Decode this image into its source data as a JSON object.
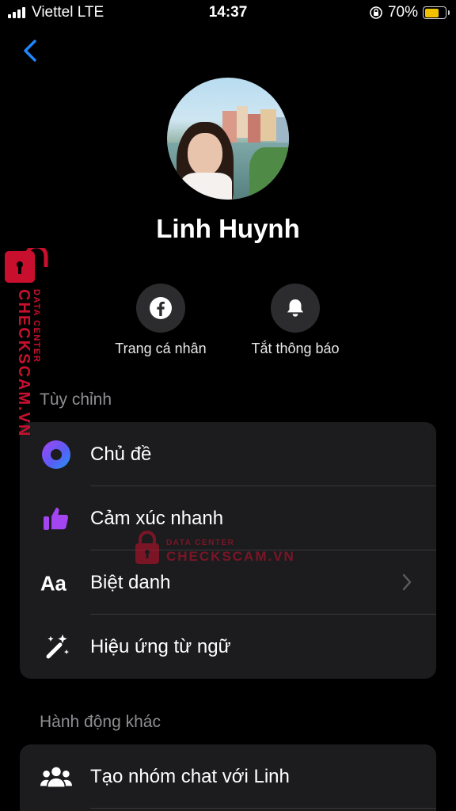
{
  "status_bar": {
    "carrier": "Viettel LTE",
    "time": "14:37",
    "battery_percent": "70%",
    "battery_level": 0.7
  },
  "profile": {
    "name": "Linh Huynh"
  },
  "actions": [
    {
      "label": "Trang cá nhân",
      "icon": "facebook-icon"
    },
    {
      "label": "Tắt thông báo",
      "icon": "bell-icon"
    }
  ],
  "customize": {
    "title": "Tùy chỉnh",
    "items": [
      {
        "label": "Chủ đề",
        "icon": "theme-icon"
      },
      {
        "label": "Cảm xúc nhanh",
        "icon": "thumbs-up-icon"
      },
      {
        "label": "Biệt danh",
        "icon": "aa-icon"
      },
      {
        "label": "Hiệu ứng từ ngữ",
        "icon": "magic-wand-icon"
      }
    ]
  },
  "other_actions": {
    "title": "Hành động khác",
    "items": [
      {
        "label": "Tạo nhóm chat với Linh",
        "icon": "group-icon"
      }
    ]
  },
  "watermark": {
    "brand": "CHECKSCAM.VN",
    "tagline": "DATA CENTER"
  },
  "colors": {
    "background": "#000000",
    "card": "#1c1c1e",
    "accent_blue": "#1e88ff",
    "thumbs_purple": "#a445f2",
    "watermark_red": "#c8102e",
    "battery_yellow": "#f2c200"
  }
}
